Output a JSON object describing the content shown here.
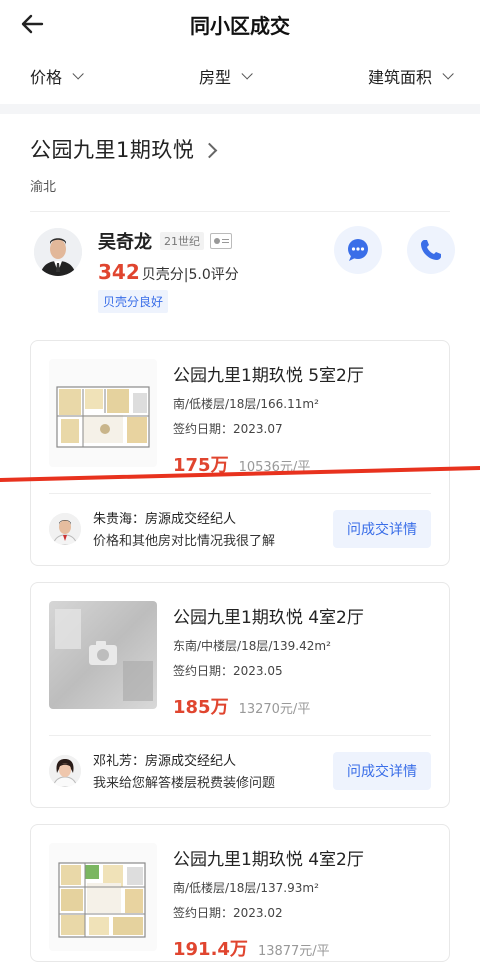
{
  "header": {
    "title": "同小区成交"
  },
  "filters": [
    {
      "label": "价格"
    },
    {
      "label": "房型"
    },
    {
      "label": "建筑面积"
    }
  ],
  "community": {
    "name": "公园九里1期玖悦",
    "district": "渝北"
  },
  "agent": {
    "name": "吴奇龙",
    "company": "21世纪",
    "score": "342",
    "score_text": "贝壳分|5.0评分",
    "badge": "贝壳分良好"
  },
  "listings": [
    {
      "title": "公园九里1期玖悦 5室2厅",
      "details": "南/低楼层/18层/166.11m²",
      "date": "签约日期：2023.07",
      "price": "175万",
      "unit_price": "10536元/平",
      "agent_line": "朱贵海：房源成交经纪人",
      "agent_desc": "价格和其他房对比情况我很了解",
      "ask_label": "问成交详情"
    },
    {
      "title": "公园九里1期玖悦 4室2厅",
      "details": "东南/中楼层/18层/139.42m²",
      "date": "签约日期：2023.05",
      "price": "185万",
      "unit_price": "13270元/平",
      "agent_line": "邓礼芳：房源成交经纪人",
      "agent_desc": "我来给您解答楼层税费装修问题",
      "ask_label": "问成交详情"
    },
    {
      "title": "公园九里1期玖悦 4室2厅",
      "details": "南/低楼层/18层/137.93m²",
      "date": "签约日期：2023.02",
      "price": "191.4万",
      "unit_price": "13877元/平"
    }
  ],
  "icons": {
    "back": "back-arrow-icon",
    "message": "chat-bubble-icon",
    "phone": "phone-icon",
    "camera": "camera-icon"
  },
  "colors": {
    "accent": "#3a6ee8",
    "price": "#e0452f",
    "annotation": "#e8321e"
  }
}
